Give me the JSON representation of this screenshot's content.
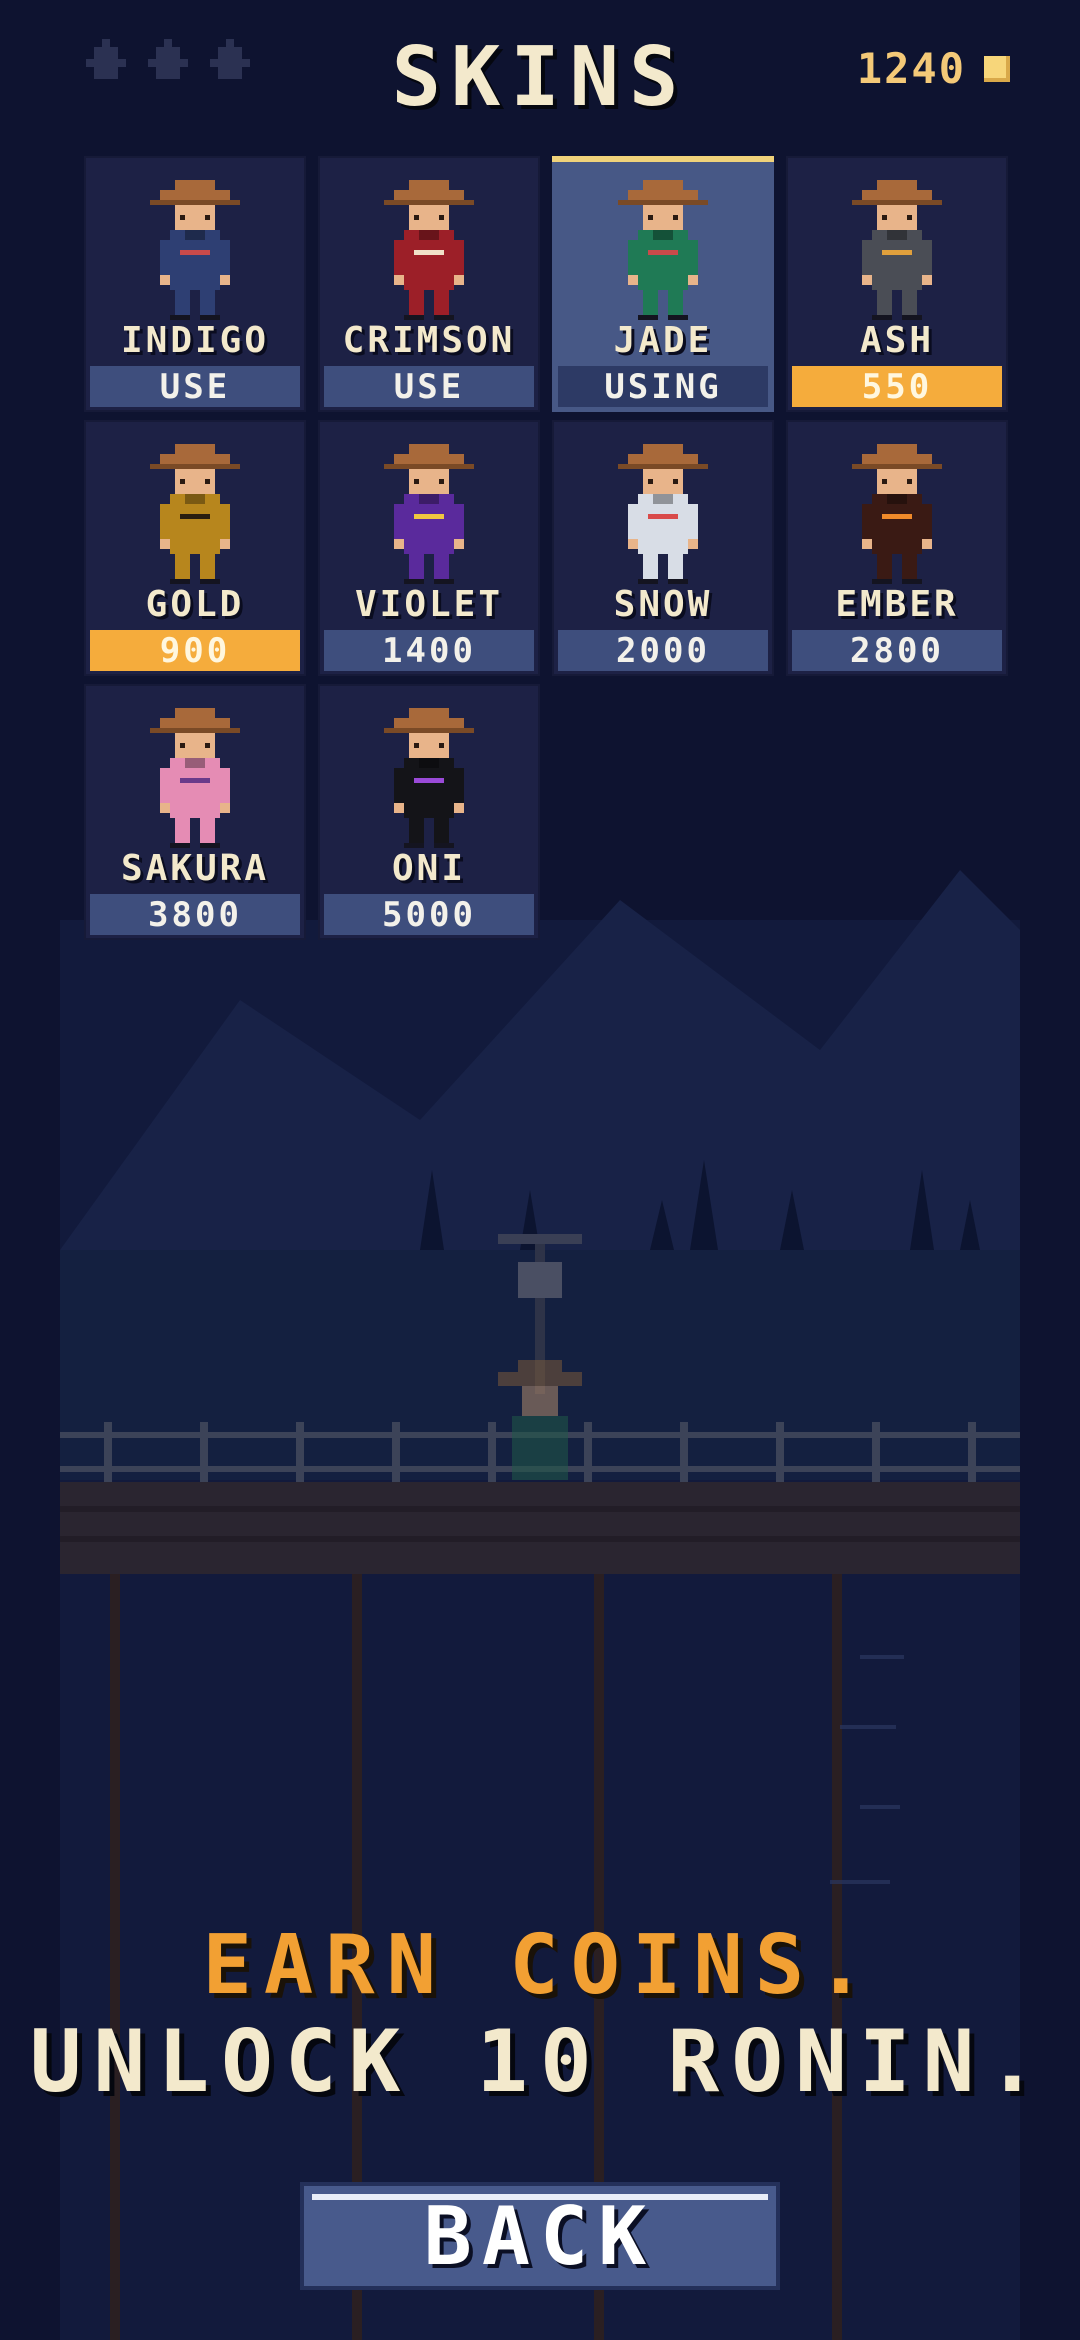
{
  "screen": {
    "title": "SKINS",
    "coins": "1240",
    "lives_count": 3
  },
  "skins": [
    {
      "name": "INDIGO",
      "action": "USE",
      "state": "owned",
      "robe": "#2e3f73",
      "belt": "#c94a4a"
    },
    {
      "name": "CRIMSON",
      "action": "USE",
      "state": "owned",
      "robe": "#9c1f28",
      "belt": "#f1e0c8"
    },
    {
      "name": "JADE",
      "action": "USING",
      "state": "selected",
      "robe": "#1f7a55",
      "belt": "#c94a4a"
    },
    {
      "name": "ASH",
      "action": "550",
      "state": "affordable",
      "robe": "#4a4d55",
      "belt": "#e0a03c"
    },
    {
      "name": "GOLD",
      "action": "900",
      "state": "affordable",
      "robe": "#b7861d",
      "belt": "#2a1e10"
    },
    {
      "name": "VIOLET",
      "action": "1400",
      "state": "locked",
      "robe": "#5a2a9c",
      "belt": "#f0c640"
    },
    {
      "name": "SNOW",
      "action": "2000",
      "state": "locked",
      "robe": "#d8dde6",
      "belt": "#d94a4a"
    },
    {
      "name": "EMBER",
      "action": "2800",
      "state": "locked",
      "robe": "#3a1a14",
      "belt": "#f08a2a"
    },
    {
      "name": "SAKURA",
      "action": "3800",
      "state": "locked",
      "robe": "#e58cb4",
      "belt": "#6a3a8a"
    },
    {
      "name": "ONI",
      "action": "5000",
      "state": "locked",
      "robe": "#141418",
      "belt": "#9a4ad8"
    }
  ],
  "tagline": {
    "line1": "EARN COINS.",
    "line2": "UNLOCK 10 RONIN."
  },
  "back_label": "BACK",
  "colors": {
    "background": "#0e1330",
    "accent": "#f5ac3c",
    "button": "#485a8c",
    "hat": "#a8693a",
    "skin": "#e8b48a"
  }
}
